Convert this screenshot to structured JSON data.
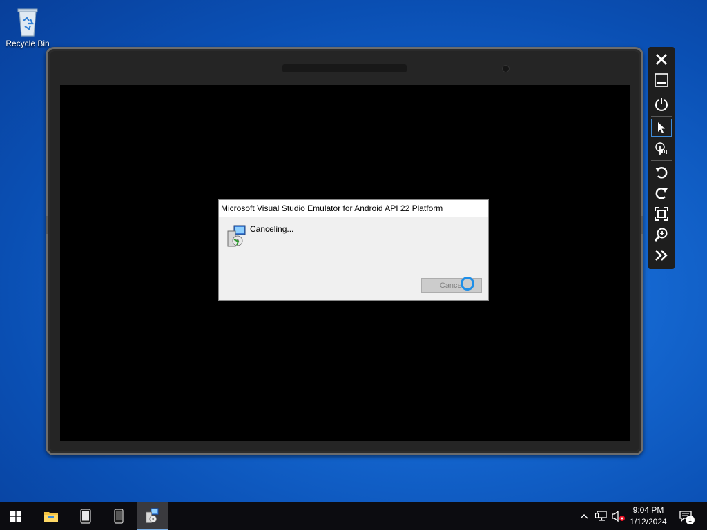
{
  "desktop": {
    "recycle_bin_label": "Recycle Bin"
  },
  "emulator": {
    "toolbar": [
      {
        "name": "close",
        "icon": "close-icon"
      },
      {
        "name": "minimize",
        "icon": "minimize-icon"
      },
      {
        "name": "power",
        "icon": "power-icon"
      },
      {
        "name": "pointer",
        "icon": "pointer-icon",
        "active": true
      },
      {
        "name": "touch",
        "icon": "touch-icon"
      },
      {
        "name": "rotate-left",
        "icon": "rotate-left-icon"
      },
      {
        "name": "rotate-right",
        "icon": "rotate-right-icon"
      },
      {
        "name": "fit-screen",
        "icon": "fit-screen-icon"
      },
      {
        "name": "zoom",
        "icon": "zoom-icon"
      },
      {
        "name": "more",
        "icon": "chevron-double-right-icon"
      }
    ]
  },
  "dialog": {
    "title": "Microsoft Visual Studio Emulator for Android API 22 Platform",
    "status": "Canceling...",
    "cancel_label": "Cancel"
  },
  "taskbar": {
    "items": [
      {
        "name": "start",
        "icon": "windows-start-icon"
      },
      {
        "name": "file-explorer",
        "icon": "folder-icon"
      },
      {
        "name": "emulator-tablet",
        "icon": "tablet-icon"
      },
      {
        "name": "emulator-phone",
        "icon": "phone-icon"
      },
      {
        "name": "installer",
        "icon": "installer-icon",
        "active": true
      }
    ],
    "tray": {
      "notification_count": "1"
    },
    "clock": {
      "time": "9:04 PM",
      "date": "1/12/2024"
    }
  },
  "colors": {
    "desktop_blue": "#1466cf",
    "accent": "#1f8fe8",
    "taskbar": "#0c0c10"
  }
}
